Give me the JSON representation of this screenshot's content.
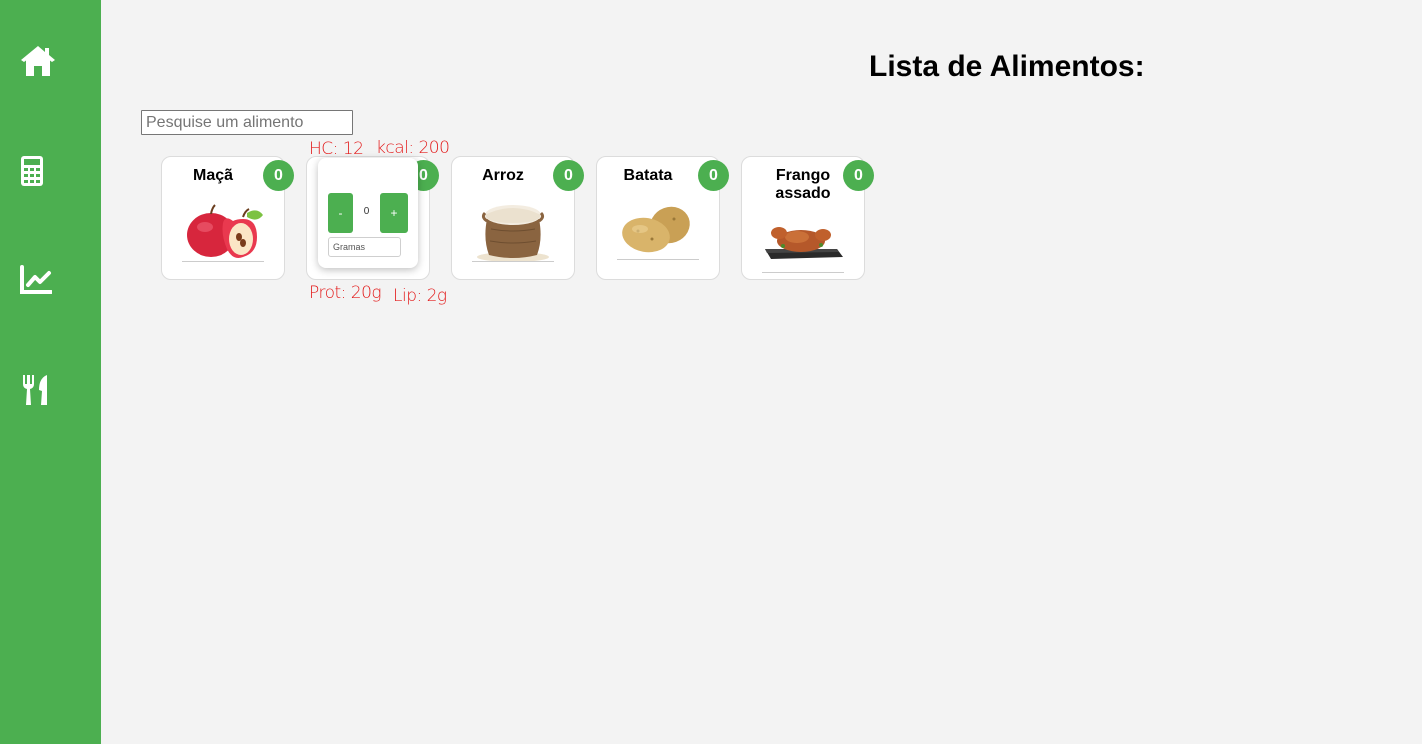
{
  "sidebar": {
    "items": [
      {
        "icon": "home-icon"
      },
      {
        "icon": "calculator-icon"
      },
      {
        "icon": "chart-line-icon"
      },
      {
        "icon": "utensils-icon"
      }
    ]
  },
  "page": {
    "title": "Lista de Alimentos:"
  },
  "search": {
    "placeholder": "Pesquise um alimento",
    "value": ""
  },
  "foods": [
    {
      "name": "Maçã",
      "count": "0",
      "image": "apple"
    },
    {
      "name": "",
      "count": "0",
      "image": "hidden"
    },
    {
      "name": "Arroz",
      "count": "0",
      "image": "rice-sack"
    },
    {
      "name": "Batata",
      "count": "0",
      "image": "potatoes"
    },
    {
      "name": "Frango assado",
      "count": "0",
      "image": "roast-chicken"
    }
  ],
  "quantity_panel": {
    "minus_label": "-",
    "plus_label": "+",
    "quantity": "0",
    "grams_placeholder": "Gramas"
  },
  "nutrition": {
    "hc": "HC: 12",
    "kcal": "kcal: 200",
    "prot": "Prot: 20g",
    "lip": "Lip: 2g"
  },
  "colors": {
    "accent": "#4caf50",
    "annotation": "#e31b1b",
    "background": "#f3f3f3"
  }
}
